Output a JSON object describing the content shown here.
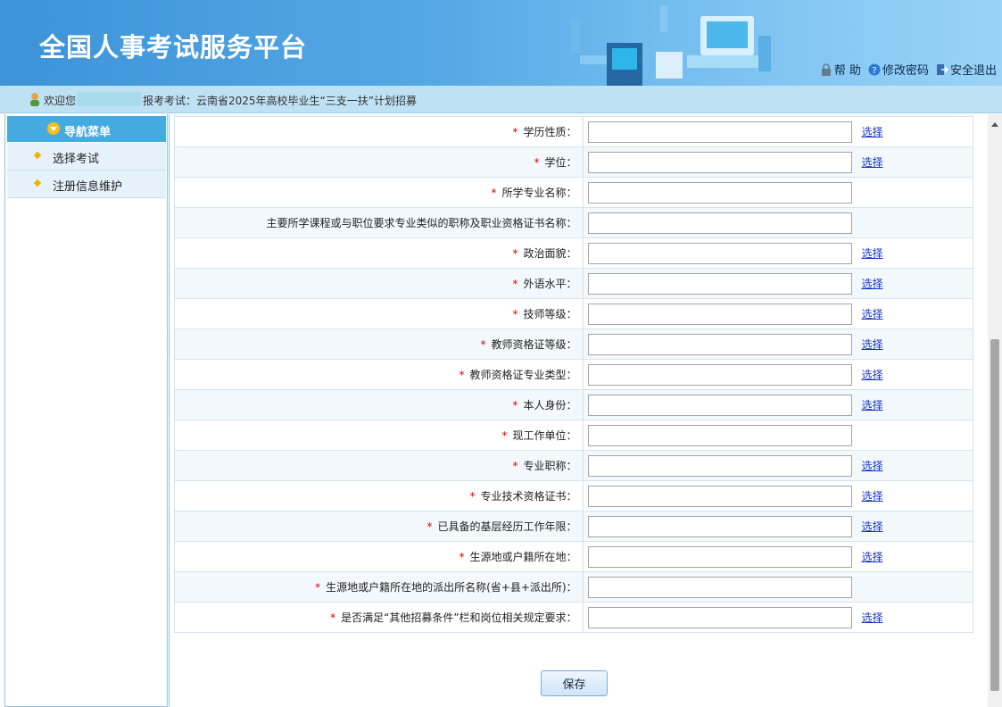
{
  "header": {
    "title": "全国人事考试服务平台",
    "links": [
      {
        "label": "帮 助",
        "icon": "lock-icon"
      },
      {
        "label": "修改密码",
        "icon": "help-icon"
      },
      {
        "label": "安全退出",
        "icon": "exit-icon"
      }
    ]
  },
  "welcome": {
    "greeting": "欢迎您",
    "exam_text": "报考考试：云南省2025年高校毕业生“三支一扶”计划招募"
  },
  "sidebar": {
    "header": "导航菜单",
    "items": [
      {
        "label": "选择考试"
      },
      {
        "label": "注册信息维护"
      }
    ]
  },
  "form": {
    "select_label": "选择",
    "rows": [
      {
        "label": "学历性质：",
        "required": true,
        "select": true,
        "value": ""
      },
      {
        "label": "学位：",
        "required": true,
        "select": true,
        "value": ""
      },
      {
        "label": "所学专业名称：",
        "required": true,
        "select": false,
        "value": ""
      },
      {
        "label": "主要所学课程或与职位要求专业类似的职称及职业资格证书名称：",
        "required": false,
        "select": false,
        "value": ""
      },
      {
        "label": "政治面貌：",
        "required": true,
        "select": true,
        "value": ""
      },
      {
        "label": "外语水平：",
        "required": true,
        "select": true,
        "value": ""
      },
      {
        "label": "技师等级：",
        "required": true,
        "select": true,
        "value": ""
      },
      {
        "label": "教师资格证等级：",
        "required": true,
        "select": true,
        "value": ""
      },
      {
        "label": "教师资格证专业类型：",
        "required": true,
        "select": true,
        "value": ""
      },
      {
        "label": "本人身份：",
        "required": true,
        "select": true,
        "value": ""
      },
      {
        "label": "现工作单位：",
        "required": true,
        "select": false,
        "value": ""
      },
      {
        "label": "专业职称：",
        "required": true,
        "select": true,
        "value": ""
      },
      {
        "label": "专业技术资格证书：",
        "required": true,
        "select": true,
        "value": ""
      },
      {
        "label": "已具备的基层经历工作年限：",
        "required": true,
        "select": true,
        "value": ""
      },
      {
        "label": "生源地或户籍所在地：",
        "required": true,
        "select": true,
        "value": ""
      },
      {
        "label": "生源地或户籍所在地的派出所名称(省+县+派出所)：",
        "required": true,
        "select": false,
        "value": ""
      },
      {
        "label": "是否满足“其他招募条件”栏和岗位相关规定要求：",
        "required": true,
        "select": true,
        "value": ""
      }
    ]
  },
  "save_label": "保存",
  "colors": {
    "header_blue": "#3d93d8",
    "welcome_bar": "#bfe1f4",
    "nav_header": "#45aadf",
    "required": "#e00000",
    "link": "#1533c8"
  }
}
